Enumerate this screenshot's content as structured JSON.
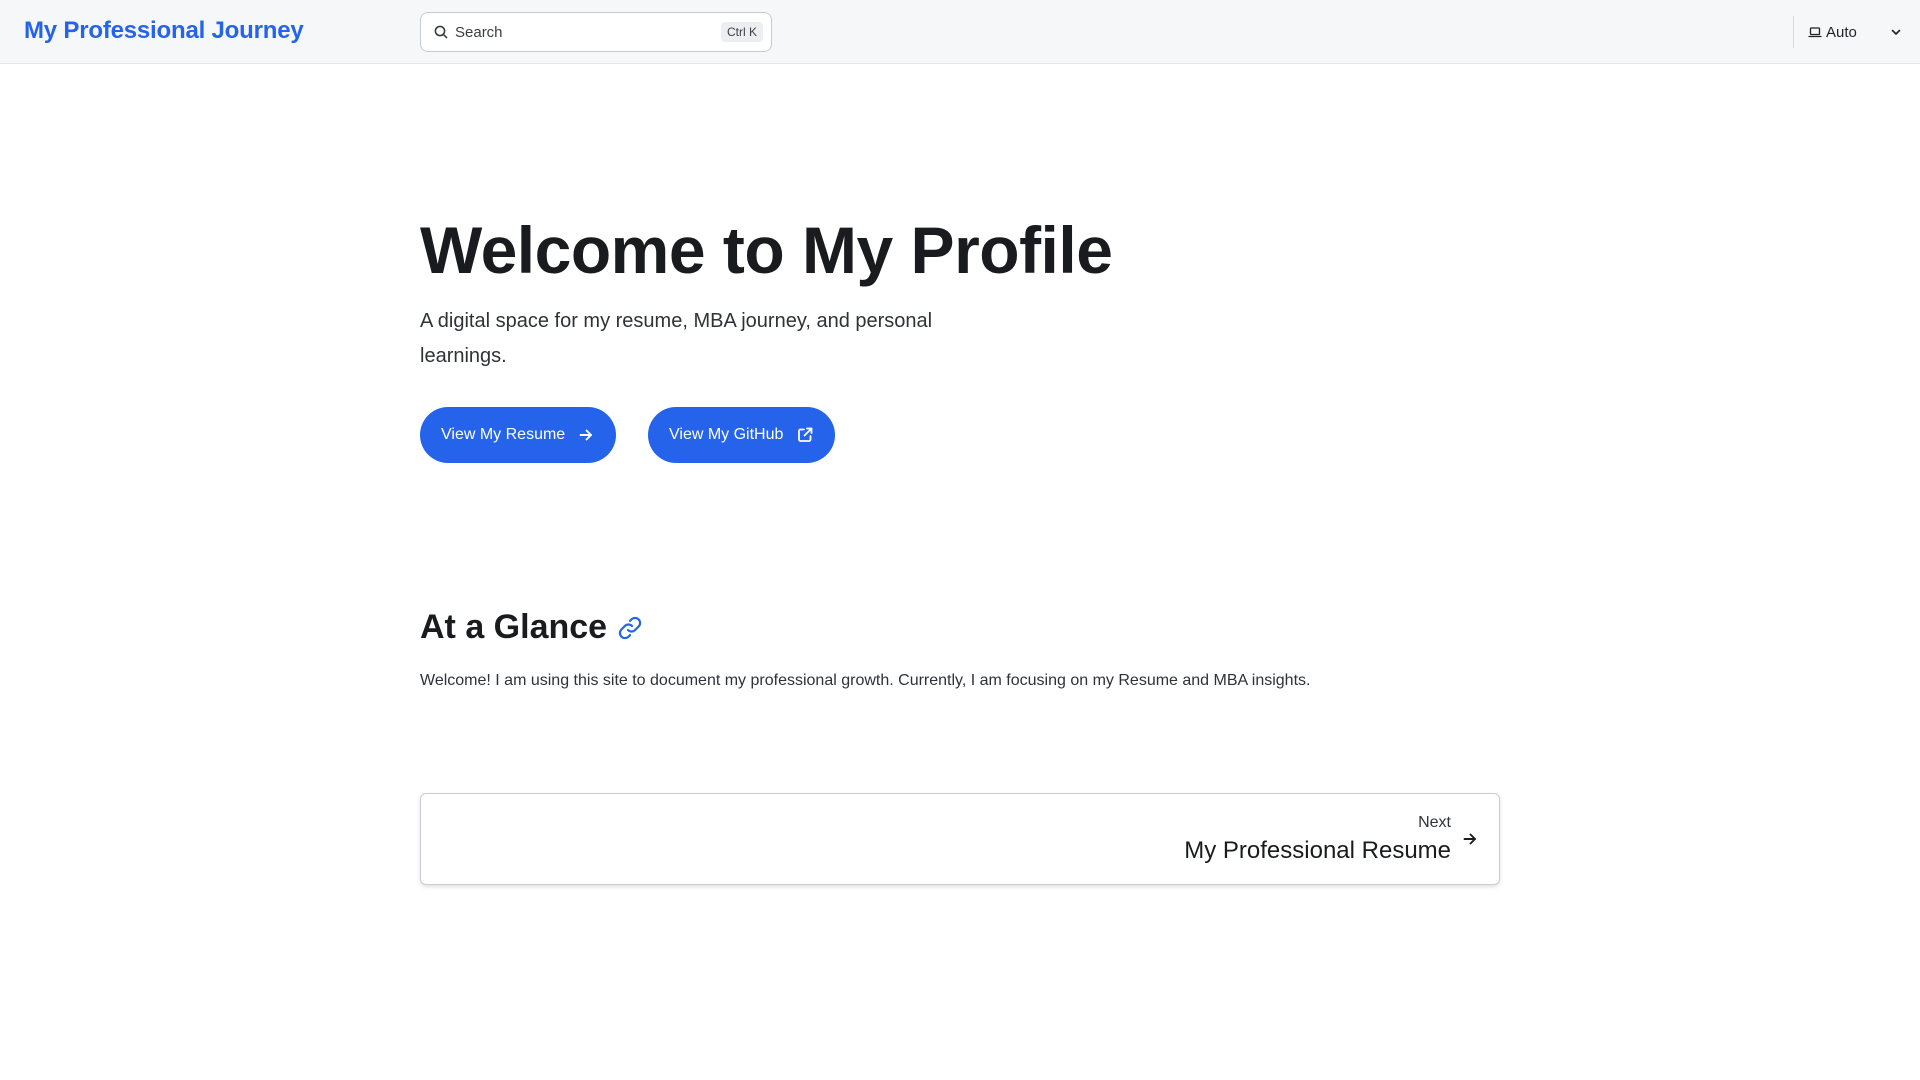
{
  "header": {
    "site_title": "My Professional Journey",
    "search": {
      "placeholder": "Search",
      "shortcut": "Ctrl K",
      "icon": "search-icon"
    },
    "theme": {
      "label": "Auto",
      "icon": "laptop-icon",
      "dropdown_icon": "chevron-down-icon"
    }
  },
  "hero": {
    "title": "Welcome to My Profile",
    "subtitle": "A digital space for my resume, MBA journey, and personal learnings.",
    "buttons": [
      {
        "label": "View My Resume",
        "icon": "arrow-right-icon"
      },
      {
        "label": "View My GitHub",
        "icon": "external-link-icon"
      }
    ]
  },
  "section": {
    "heading": "At a Glance",
    "anchor_icon": "link-icon",
    "text": "Welcome! I am using this site to document my professional growth. Currently, I am focusing on my Resume and MBA insights."
  },
  "pagination": {
    "next_label": "Next",
    "next_title": "My Professional Resume",
    "icon": "arrow-right-icon"
  },
  "colors": {
    "accent": "#2563eb",
    "header_bg": "#f6f7f9",
    "text": "#1a1b1e"
  }
}
